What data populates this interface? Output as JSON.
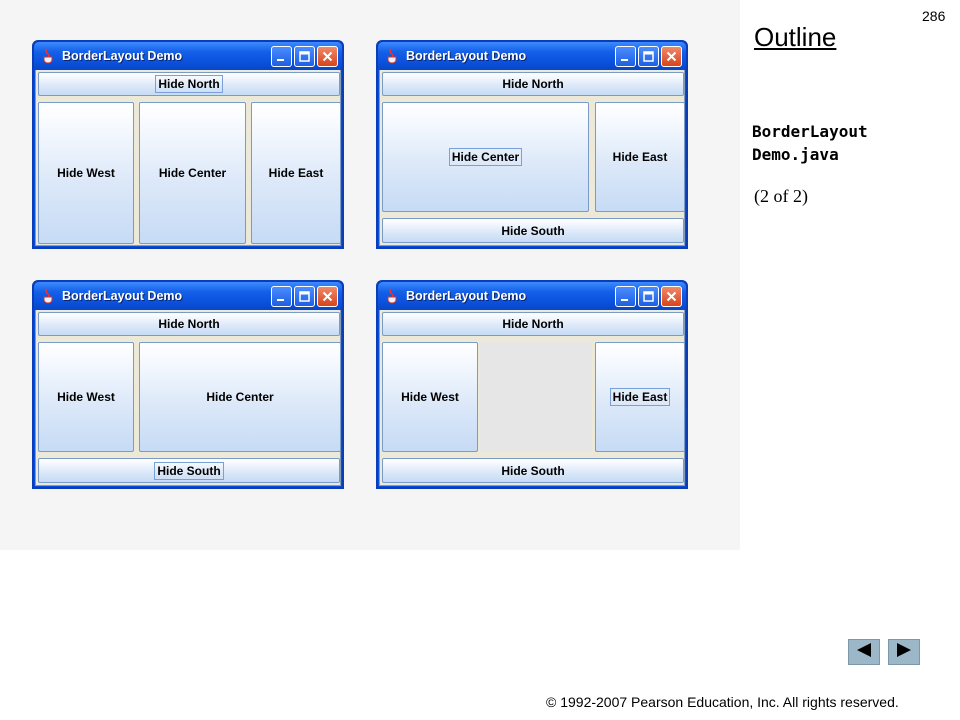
{
  "slide": {
    "number": "286",
    "outline_title": "Outline",
    "file_line1": "BorderLayout",
    "file_line2": "Demo.java",
    "page_of": "(2 of 2)",
    "copyright": "© 1992-2007 Pearson Education, Inc.  All rights reserved."
  },
  "windows": [
    {
      "title": "BorderLayout Demo",
      "north": "Hide North",
      "west": "Hide West",
      "center": "Hide Center",
      "east": "Hide East"
    },
    {
      "title": "BorderLayout Demo",
      "north": "Hide North",
      "center": "Hide Center",
      "east": "Hide East",
      "south": "Hide South"
    },
    {
      "title": "BorderLayout Demo",
      "north": "Hide North",
      "west": "Hide West",
      "center": "Hide Center",
      "south": "Hide South"
    },
    {
      "title": "BorderLayout Demo",
      "north": "Hide North",
      "west": "Hide West",
      "east": "Hide East",
      "south": "Hide South"
    }
  ],
  "icons": {
    "window_app": "java-cup-icon",
    "minimize": "minimize-icon",
    "maximize": "maximize-icon",
    "close": "close-icon",
    "prev": "previous-slide-icon",
    "next": "next-slide-icon"
  },
  "colors": {
    "titlebar": "#0b52de",
    "button_gradient_bottom": "#c6dbf5",
    "panel_bg": "#f5f5f5",
    "nav_button": "#9cb8c8"
  }
}
